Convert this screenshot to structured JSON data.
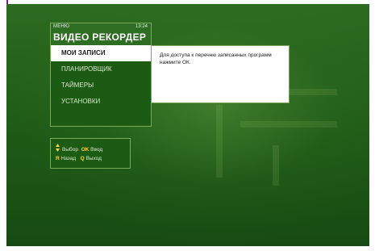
{
  "header": {
    "menu_label": "МЕНЮ",
    "clock": "13:24",
    "title": "ВИДЕО РЕКОРДЕР"
  },
  "menu": {
    "items": [
      {
        "label": "МОИ ЗАПИСИ",
        "selected": true
      },
      {
        "label": "ПЛАНИРОВЩИК",
        "selected": false
      },
      {
        "label": "ТАЙМЕРЫ",
        "selected": false
      },
      {
        "label": "УСТАНОВКИ",
        "selected": false
      }
    ]
  },
  "info_panel": {
    "text": "Для доступа к перечню записанных программ нажмите ОК."
  },
  "legend": {
    "select_label": "Выбор",
    "ok_key": "OK",
    "enter_label": "Ввод",
    "back_key": "R",
    "back_label": "Назад",
    "exit_key": "Q",
    "exit_label": "Выход"
  },
  "colors": {
    "background": "#1e5a16",
    "panel": "#1c5b13",
    "highlight": "#ffffff",
    "key_accent": "#ffd23a"
  }
}
